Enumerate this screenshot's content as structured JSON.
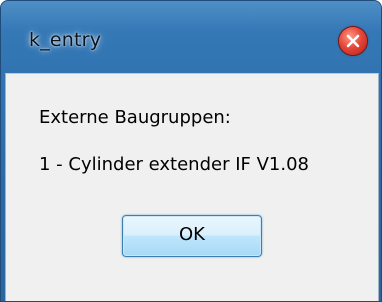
{
  "window": {
    "title": "k_entry"
  },
  "titlebar": {
    "close_icon": "close-icon"
  },
  "message": {
    "line1": "Externe Baugruppen:",
    "line2": "1 - Cylinder extender IF V1.08"
  },
  "buttons": {
    "ok_label": "OK"
  },
  "colors": {
    "titlebar": "#2b6aa6",
    "client_bg": "#f0f0f0",
    "close_red": "#e5483a",
    "button_border": "#3c7fb1"
  }
}
